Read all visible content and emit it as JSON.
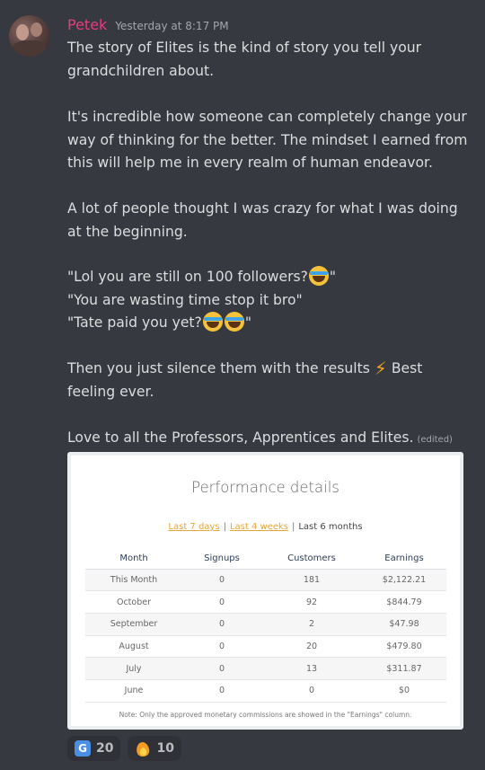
{
  "message": {
    "author": "Petek",
    "timestamp": "Yesterday at 8:17 PM",
    "paragraphs": {
      "p1": "The story of Elites is the kind of story you tell your grandchildren about.",
      "p2": "It's incredible how someone can completely change your way of thinking for the better. The mindset I earned from this will help me in every realm of human endeavor.",
      "p3": "A lot of people thought I was crazy for what I was doing at the beginning.",
      "q1": "\"Lol you are still on 100 followers?",
      "q1_end": "\"",
      "q2": "\"You are wasting time stop it bro\"",
      "q3": "\"Tate paid you yet?",
      "q3_end": "\"",
      "p5a": "Then you just silence them with the results",
      "p5b": "Best feeling ever.",
      "p6": "Love to all the Professors, Apprentices and Elites.",
      "edited": "(edited)"
    },
    "emojis": {
      "joy": "joy-emoji",
      "bolt": "⚡"
    }
  },
  "card": {
    "title": "Performance details",
    "tabs": {
      "t1": "Last 7 days",
      "t2": "Last 4 weeks",
      "t3": "Last 6 months",
      "sep": "|"
    },
    "columns": [
      "Month",
      "Signups",
      "Customers",
      "Earnings"
    ],
    "rows": [
      [
        "This Month",
        "0",
        "181",
        "$2,122.21"
      ],
      [
        "October",
        "0",
        "92",
        "$844.79"
      ],
      [
        "September",
        "0",
        "2",
        "$47.98"
      ],
      [
        "August",
        "0",
        "20",
        "$479.80"
      ],
      [
        "July",
        "0",
        "13",
        "$311.87"
      ],
      [
        "June",
        "0",
        "0",
        "$0"
      ]
    ],
    "note": "Note: Only the approved monetary commissions are showed in the \"Earnings\" column.",
    "link_color": "#e5a63a"
  },
  "reactions": [
    {
      "icon": "g-icon",
      "glyph": "G",
      "count": "20"
    },
    {
      "icon": "fire-icon",
      "count": "10"
    }
  ],
  "colors": {
    "background": "#36393f",
    "username": "#e63c82",
    "text": "#dcddde"
  }
}
